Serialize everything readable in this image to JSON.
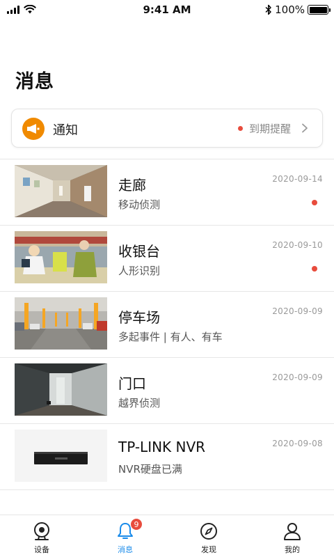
{
  "status_bar": {
    "time": "9:41 AM",
    "battery": "100%"
  },
  "page": {
    "title": "消息"
  },
  "notice": {
    "label": "通知",
    "right_text": "到期提醒"
  },
  "messages": [
    {
      "title": "走廊",
      "subtitle": "移动侦测",
      "date": "2020-09-14",
      "unread": true
    },
    {
      "title": "收银台",
      "subtitle": "人形识别",
      "date": "2020-09-10",
      "unread": true
    },
    {
      "title": "停车场",
      "subtitle": "多起事件 | 有人、有车",
      "date": "2020-09-09",
      "unread": false
    },
    {
      "title": "门口",
      "subtitle": "越界侦测",
      "date": "2020-09-09",
      "unread": false
    },
    {
      "title": "TP-LINK NVR",
      "subtitle": "NVR硬盘已满",
      "date": "2020-09-08",
      "unread": false
    }
  ],
  "tabbar": {
    "tabs": [
      {
        "label": "设备",
        "icon": "camera-icon",
        "active": false
      },
      {
        "label": "消息",
        "icon": "bell-icon",
        "active": true,
        "badge": "9"
      },
      {
        "label": "发现",
        "icon": "compass-icon",
        "active": false
      },
      {
        "label": "我的",
        "icon": "user-icon",
        "active": false
      }
    ]
  },
  "colors": {
    "accent": "#1a8bea",
    "notice_icon_bg": "#f08a00",
    "unread_dot": "#e84c3d"
  }
}
